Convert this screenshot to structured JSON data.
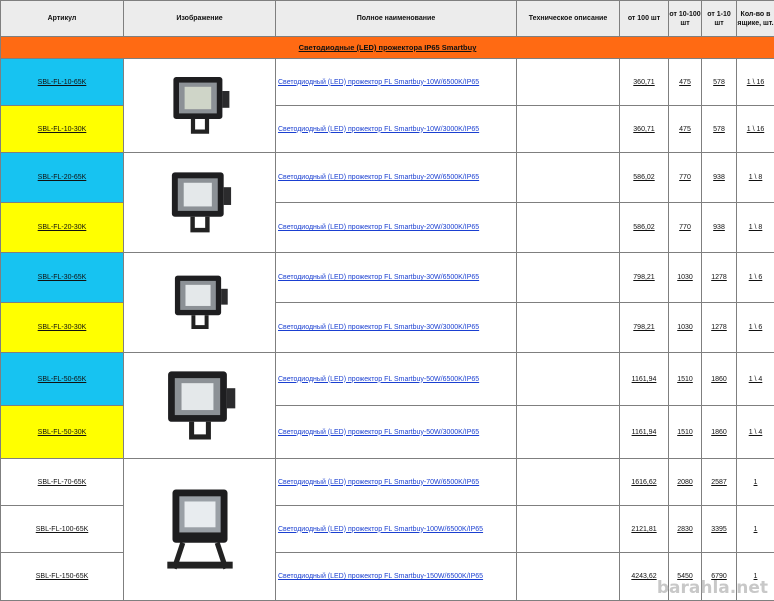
{
  "headers": {
    "article": "Артикул",
    "image": "Изображение",
    "full_name": "Полное наименование",
    "tech": "Техническое описание",
    "from100": "от 100 шт",
    "from10": "от 10-100 шт",
    "from1": "от 1-10 шт",
    "box": "Кол-во в ящике, шт."
  },
  "section_title": "Светодиодные (LED) прожектора IP65 Smartbuy",
  "rows": [
    {
      "sku": "SBL-FL-10-65K",
      "name": "Светодиодный (LED) прожектор FL Smartbuy-10W/6500K/IP65",
      "p100": "360,71",
      "p10": "475",
      "p1": "578",
      "box": "1 \\ 16"
    },
    {
      "sku": "SBL-FL-10-30K",
      "name": "Светодиодный (LED) прожектор FL Smartbuy-10W/3000K/IP65",
      "p100": "360,71",
      "p10": "475",
      "p1": "578",
      "box": "1 \\ 16"
    },
    {
      "sku": "SBL-FL-20-65K",
      "name": "Светодиодный (LED) прожектор FL Smartbuy-20W/6500K/IP65",
      "p100": "586,02",
      "p10": "770",
      "p1": "938",
      "box": "1 \\ 8"
    },
    {
      "sku": "SBL-FL-20-30K",
      "name": "Светодиодный (LED) прожектор FL Smartbuy-20W/3000K/IP65",
      "p100": "586,02",
      "p10": "770",
      "p1": "938",
      "box": "1 \\ 8"
    },
    {
      "sku": "SBL-FL-30-65K",
      "name": "Светодиодный (LED) прожектор FL Smartbuy-30W/6500K/IP65",
      "p100": "798,21",
      "p10": "1030",
      "p1": "1278",
      "box": "1 \\ 6"
    },
    {
      "sku": "SBL-FL-30-30K",
      "name": "Светодиодный (LED) прожектор FL Smartbuy-30W/3000K/IP65",
      "p100": "798,21",
      "p10": "1030",
      "p1": "1278",
      "box": "1 \\ 6"
    },
    {
      "sku": "SBL-FL-50-65K",
      "name": "Светодиодный (LED) прожектор FL Smartbuy-50W/6500K/IP65",
      "p100": "1161,94",
      "p10": "1510",
      "p1": "1860",
      "box": "1 \\ 4"
    },
    {
      "sku": "SBL-FL-50-30K",
      "name": "Светодиодный (LED) прожектор FL Smartbuy-50W/3000K/IP65",
      "p100": "1161,94",
      "p10": "1510",
      "p1": "1860",
      "box": "1 \\ 4"
    },
    {
      "sku": "SBL-FL-70-65K",
      "name": "Светодиодный (LED) прожектор FL Smartbuy-70W/6500K/IP65",
      "p100": "1616,62",
      "p10": "2080",
      "p1": "2587",
      "box": "1"
    },
    {
      "sku": "SBL-FL-100-65K",
      "name": "Светодиодный (LED) прожектор FL Smartbuy-100W/6500K/IP65",
      "p100": "2121,81",
      "p10": "2830",
      "p1": "3395",
      "box": "1"
    },
    {
      "sku": "SBL-FL-150-65K",
      "name": "Светодиодный (LED) прожектор FL Smartbuy-150W/6500K/IP65",
      "p100": "4243,62",
      "p10": "5450",
      "p1": "6790",
      "box": "1"
    }
  ],
  "colors": {
    "cyan": "#17c3f1",
    "yellow": "#ffff00",
    "section": "#ff6a13",
    "link": "#1a3fd1"
  },
  "watermark": "barahla.net"
}
